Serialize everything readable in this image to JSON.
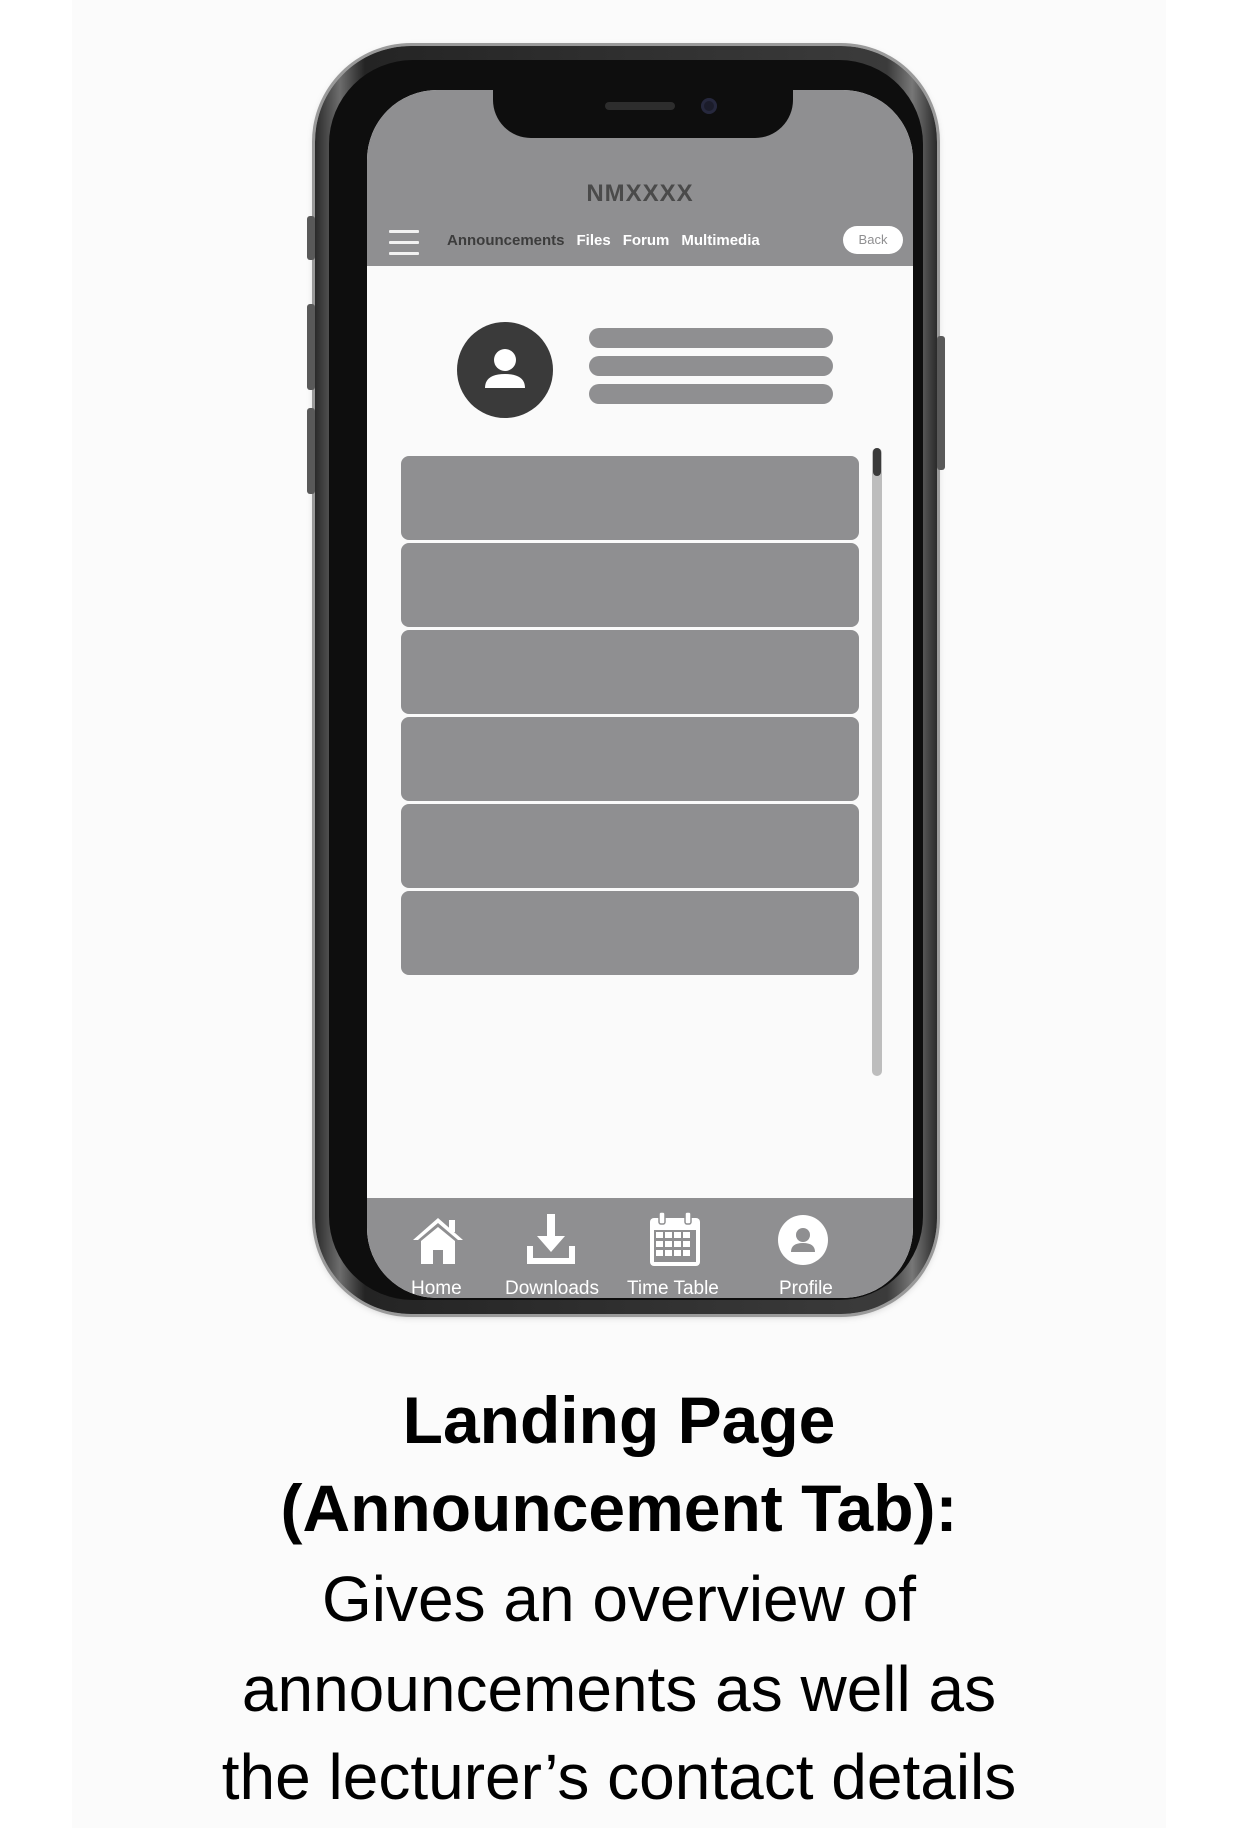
{
  "app": {
    "title": "NMXXXX"
  },
  "header": {
    "menu_icon": "hamburger-menu-icon",
    "tabs": [
      {
        "label": "Announcements",
        "active": true
      },
      {
        "label": "Files",
        "active": false
      },
      {
        "label": "Forum",
        "active": false
      },
      {
        "label": "Multimedia",
        "active": false
      }
    ],
    "back_label": "Back"
  },
  "lecturer": {
    "avatar_icon": "user-avatar-icon"
  },
  "announcements": {
    "card_count": 6
  },
  "bottom_nav": {
    "items": [
      {
        "label": "Home",
        "icon": "home-icon"
      },
      {
        "label": "Downloads",
        "icon": "download-icon"
      },
      {
        "label": "Time Table",
        "icon": "calendar-icon"
      },
      {
        "label": "Profile",
        "icon": "profile-icon"
      }
    ]
  },
  "caption": {
    "title_line1": "Landing Page",
    "title_line2": "(Announcement Tab):",
    "desc_line1": "Gives an overview of",
    "desc_line2": "announcements as well as",
    "desc_line3": "the lecturer’s contact details"
  },
  "colors": {
    "ui_gray": "#8f8f91",
    "dark": "#3a3a3a",
    "screen_bg": "#fafafa"
  }
}
